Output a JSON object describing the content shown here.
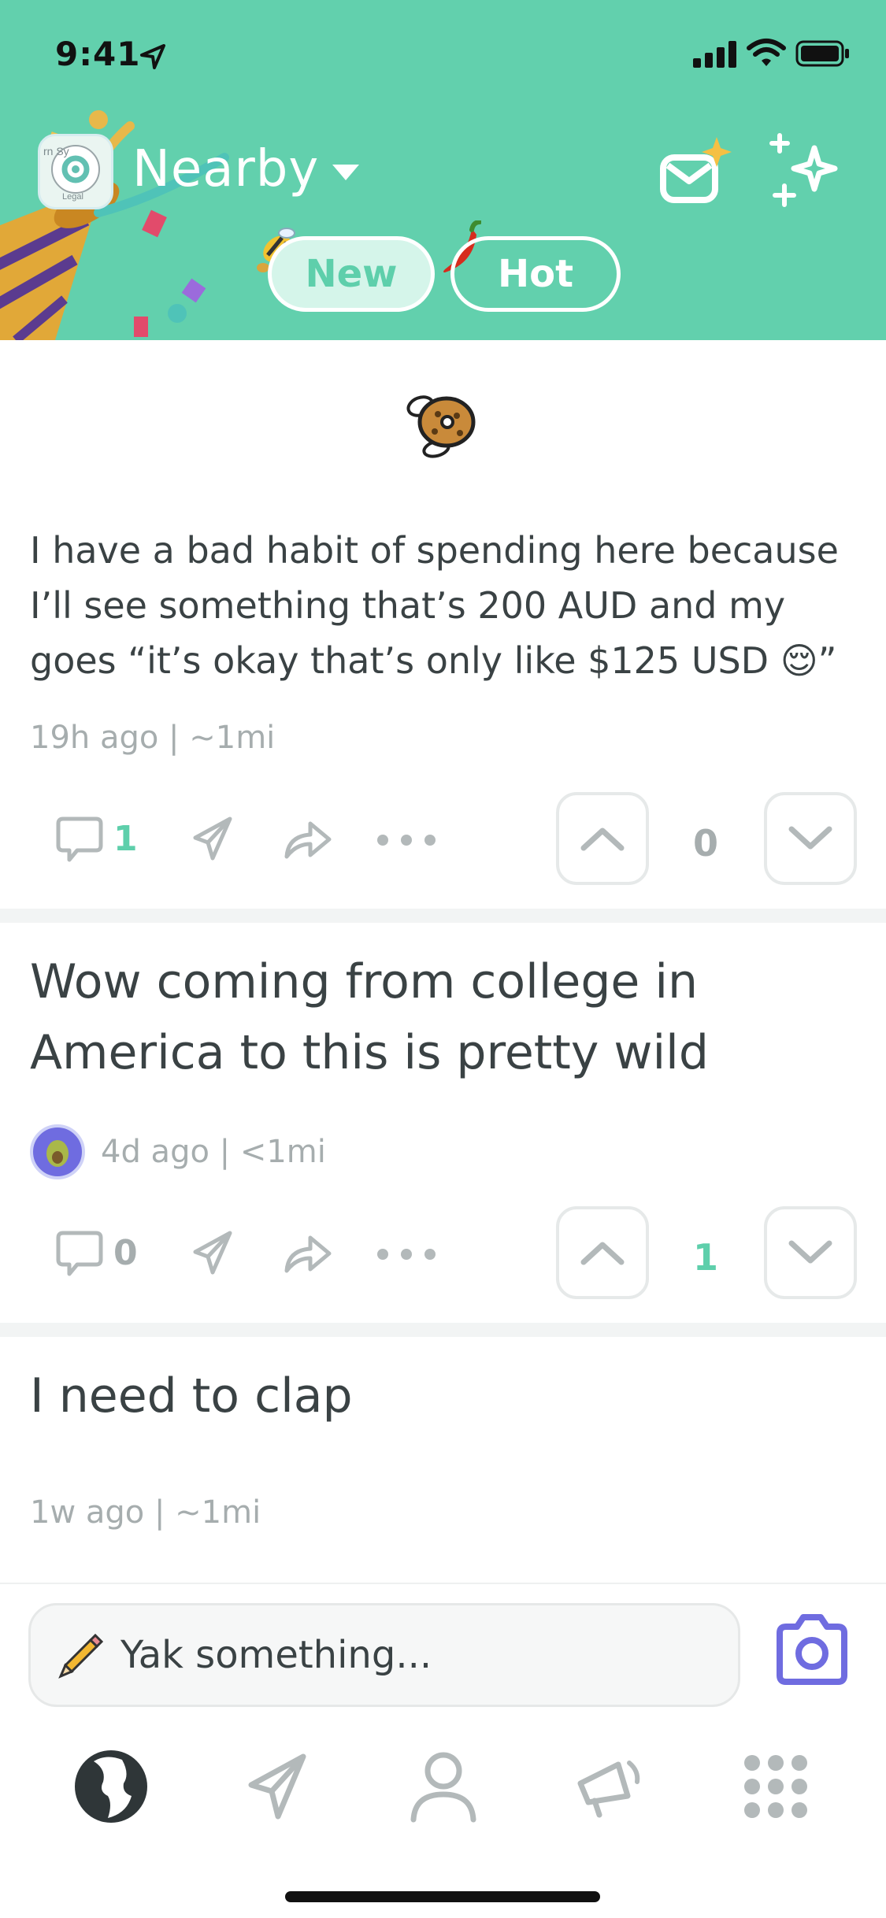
{
  "status_bar": {
    "time": "9:41"
  },
  "header": {
    "title": "Nearby",
    "logo_text_top": "rn Sy",
    "logo_text_bottom": "Legal",
    "tabs": [
      {
        "label": "New",
        "active": true
      },
      {
        "label": "Hot",
        "active": false
      }
    ]
  },
  "posts": [
    {
      "text": "I have a bad habit of spending here because I’ll see something that’s 200 AUD and my goes “it’s okay that’s only like $125 USD 😌”",
      "meta": "19h ago | ~1mi",
      "comments": "1",
      "votes": "0"
    },
    {
      "text": "Wow coming from college in America to this is pretty wild",
      "meta": "4d ago | <1mi",
      "comments": "0",
      "votes": "1"
    },
    {
      "text": "I need to clap",
      "meta": "1w ago | ~1mi"
    }
  ],
  "compose": {
    "placeholder": "Yak something..."
  },
  "colors": {
    "brand_green": "#62d0ad",
    "accent_green": "#5ecfab",
    "purple": "#6f6ce0",
    "grey": "#a6adae"
  }
}
